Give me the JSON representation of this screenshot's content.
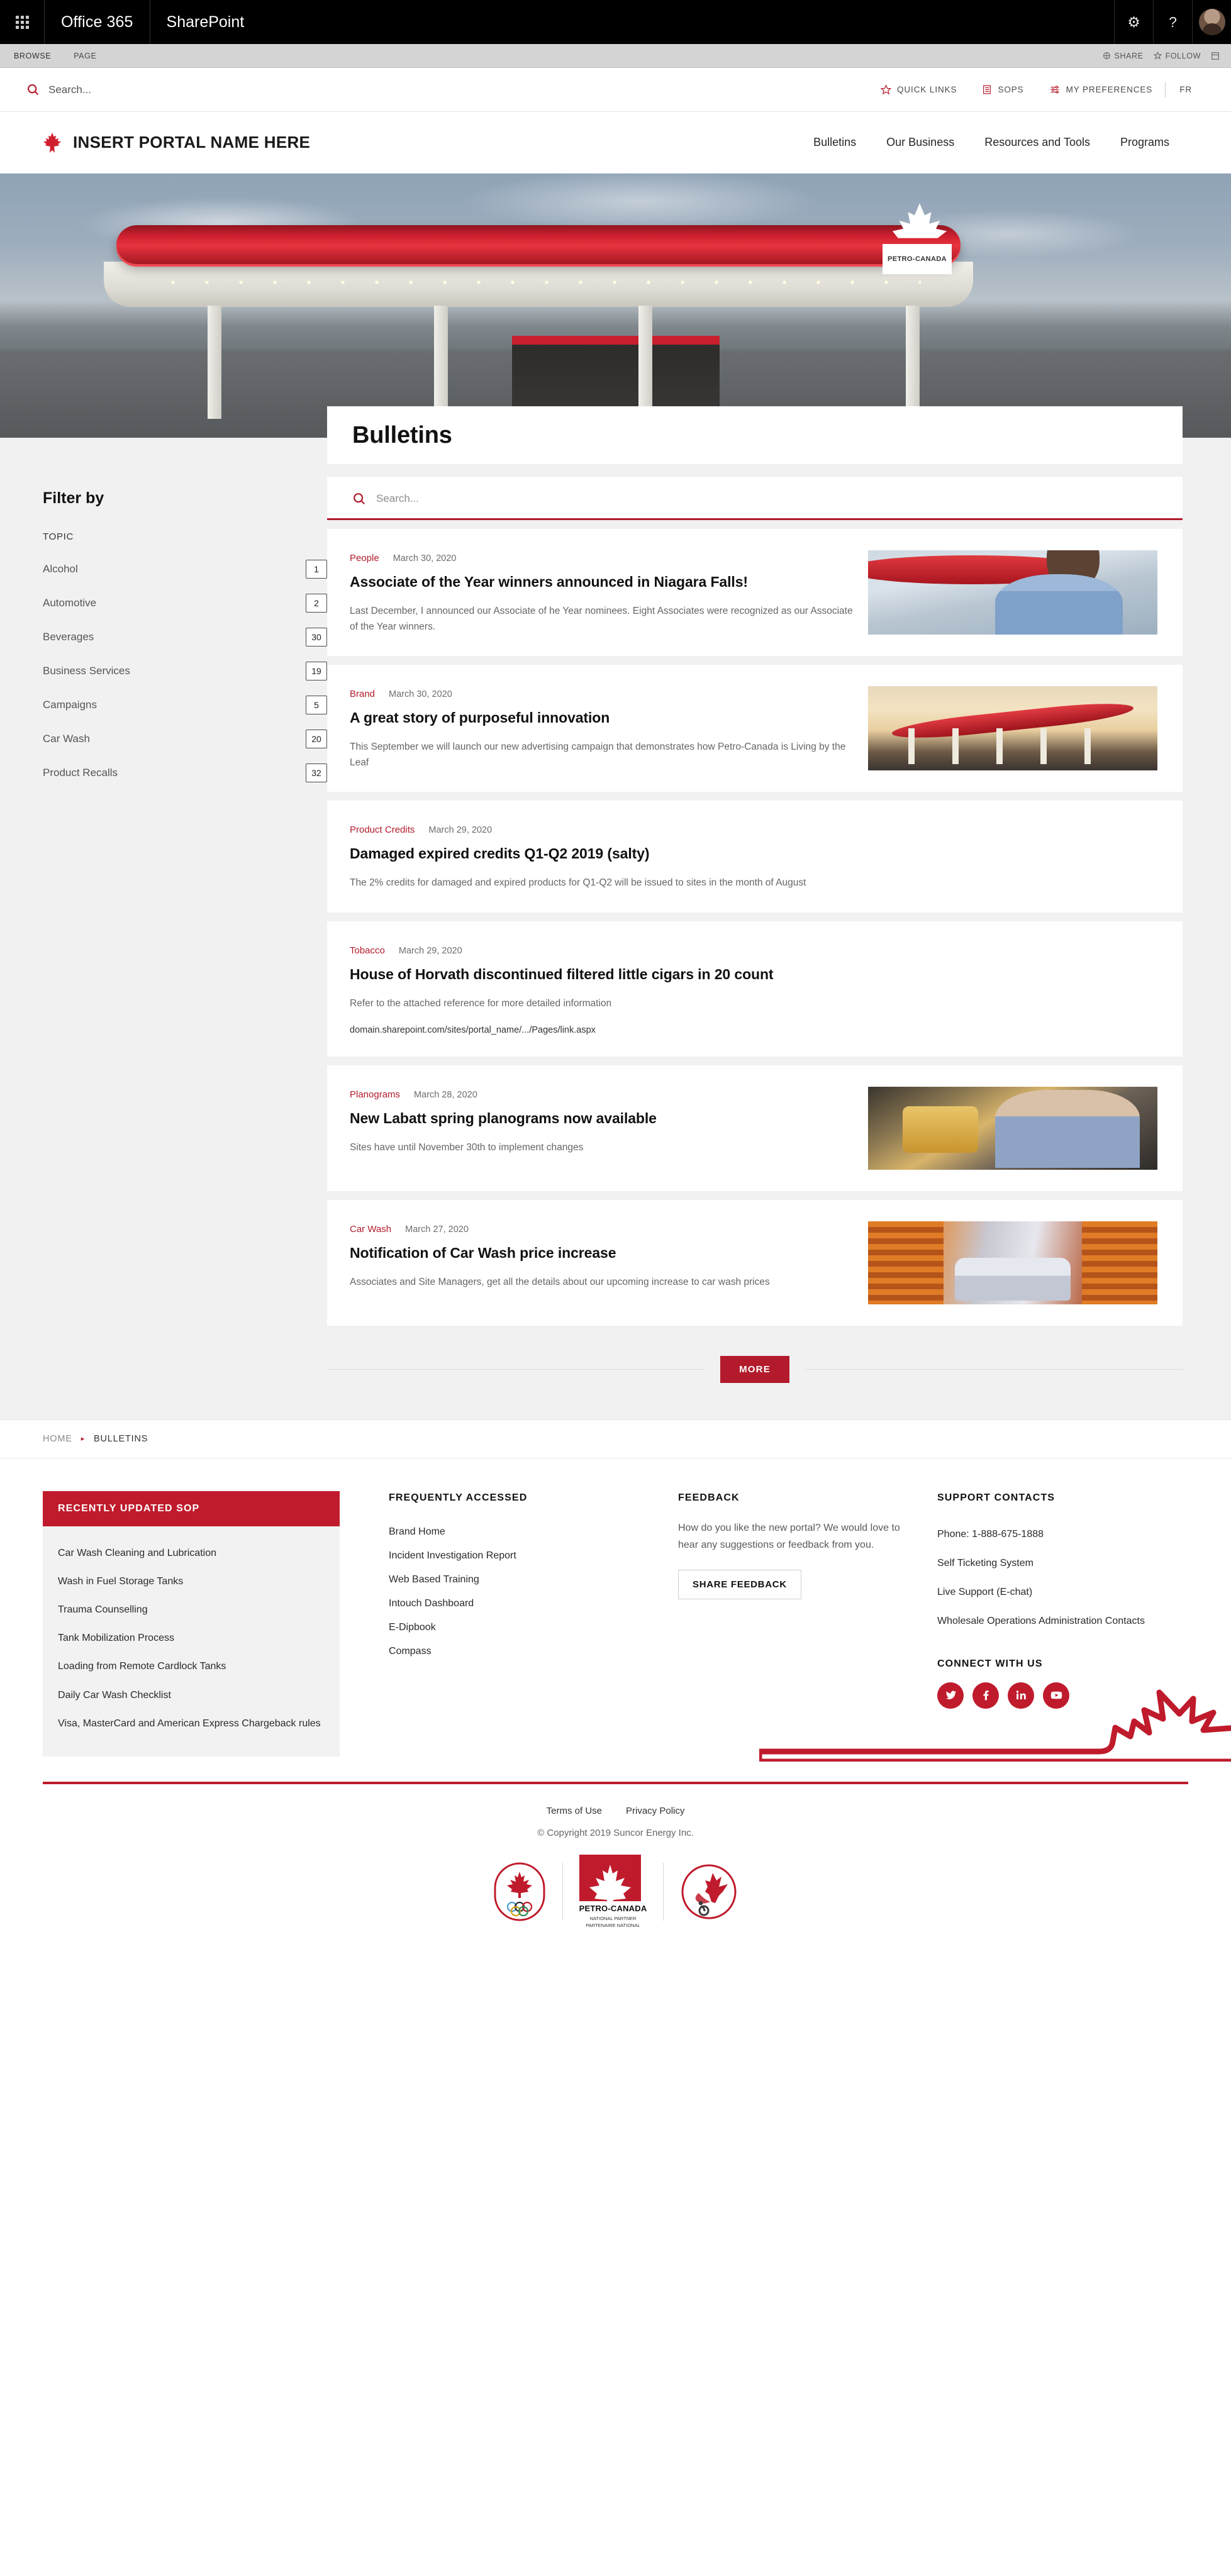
{
  "suitebar": {
    "app_launcher": "app-launcher",
    "office_brand": "Office 365",
    "app_name": "SharePoint",
    "settings_icon": "gear-icon",
    "help_icon": "help-icon",
    "avatar": "user-avatar"
  },
  "ribbon": {
    "tabs": [
      "BROWSE",
      "PAGE"
    ],
    "actions": [
      "SHARE",
      "FOLLOW"
    ],
    "focus_icon": "focus-on-content-icon"
  },
  "utility": {
    "search_placeholder": "Search...",
    "links": [
      {
        "label": "QUICK LINKS",
        "icon": "star-icon"
      },
      {
        "label": "SOPS",
        "icon": "list-icon"
      },
      {
        "label": "MY PREFERENCES",
        "icon": "sliders-icon"
      }
    ],
    "language": "FR"
  },
  "portal": {
    "logo": "maple-leaf-logo",
    "name": "INSERT PORTAL NAME HERE",
    "nav": [
      "Bulletins",
      "Our Business",
      "Resources and Tools",
      "Programs"
    ]
  },
  "hero": {
    "alt": "petro-canada-gas-station-at-dusk",
    "sign_text": "PETRO-CANADA"
  },
  "page": {
    "title": "Bulletins"
  },
  "filter": {
    "heading": "Filter by",
    "group_label": "TOPIC",
    "topics": [
      {
        "name": "Alcohol",
        "count": "1"
      },
      {
        "name": "Automotive",
        "count": "2"
      },
      {
        "name": "Beverages",
        "count": "30"
      },
      {
        "name": "Business Services",
        "count": "19"
      },
      {
        "name": "Campaigns",
        "count": "5"
      },
      {
        "name": "Car Wash",
        "count": "20"
      },
      {
        "name": "Product Recalls",
        "count": "32"
      }
    ]
  },
  "search": {
    "placeholder": "Search...",
    "icon": "search-icon"
  },
  "bulletins": [
    {
      "topic": "People",
      "date": "March 30, 2020",
      "title": "Associate of the Year winners announced in Niagara Falls!",
      "excerpt": "Last December, I announced our Associate of he Year nominees. Eight Associates were recognized as our Associate of the Year winners.",
      "link": "",
      "thumb": "associate-portrait-photo"
    },
    {
      "topic": "Brand",
      "date": "March 30, 2020",
      "title": "A great story of purposeful innovation",
      "excerpt": "This September we will launch our new advertising campaign that demonstrates how Petro-Canada is Living by the Leaf",
      "link": "",
      "thumb": "gas-station-sunset-photo"
    },
    {
      "topic": "Product Credits",
      "date": "March 29, 2020",
      "title": "Damaged expired credits Q1-Q2 2019 (salty)",
      "excerpt": "The 2% credits for damaged and expired products for Q1-Q2 will be issued to sites in the month of August",
      "link": "",
      "thumb": ""
    },
    {
      "topic": "Tobacco",
      "date": "March 29, 2020",
      "title": "House of Horvath discontinued filtered little cigars in 20 count",
      "excerpt": "Refer to the attached reference for more detailed information",
      "link": "domain.sharepoint.com/sites/portal_name/.../Pages/link.aspx",
      "thumb": ""
    },
    {
      "topic": "Planograms",
      "date": "March 28, 2020",
      "title": "New Labatt spring planograms now available",
      "excerpt": "Sites have until November 30th to implement changes",
      "link": "",
      "thumb": "shopper-holding-beverage-photo"
    },
    {
      "topic": "Car Wash",
      "date": "March 27, 2020",
      "title": "Notification of Car Wash price increase",
      "excerpt": "Associates and Site Managers, get all the details about our upcoming increase to car wash prices",
      "link": "",
      "thumb": "car-in-car-wash-photo"
    }
  ],
  "more_button": "MORE",
  "breadcrumb": {
    "home": "HOME",
    "current": "BULLETINS"
  },
  "footer": {
    "sop": {
      "heading": "RECENTLY UPDATED SOP",
      "items": [
        "Car Wash Cleaning and Lubrication",
        "Wash in Fuel Storage Tanks",
        "Trauma Counselling",
        "Tank Mobilization Process",
        "Loading from Remote Cardlock Tanks",
        "Daily Car Wash Checklist",
        "Visa, MasterCard and American Express Chargeback rules"
      ]
    },
    "frequently_accessed": {
      "heading": "FREQUENTLY ACCESSED",
      "items": [
        "Brand Home",
        "Incident Investigation Report",
        "Web Based Training",
        "Intouch Dashboard",
        "E-Dipbook",
        "Compass"
      ]
    },
    "feedback": {
      "heading": "FEEDBACK",
      "text": "How do you like the new portal? We would love to hear any suggestions or feedback from you.",
      "button": "SHARE FEEDBACK"
    },
    "support": {
      "heading": "SUPPORT CONTACTS",
      "items": [
        "Phone: 1-888-675-1888",
        "Self Ticketing System",
        "Live Support (E-chat)",
        "Wholesale Operations Administration Contacts"
      ]
    },
    "connect": {
      "heading": "CONNECT WITH US",
      "socials": [
        "twitter-icon",
        "facebook-icon",
        "linkedin-icon",
        "youtube-icon"
      ]
    },
    "legal": [
      "Terms of Use",
      "Privacy Policy"
    ],
    "copyright": "© Copyright 2019 Suncor Energy Inc.",
    "logos": {
      "olympic": "canadian-olympic-team-logo",
      "petro_word": "PETRO-CANADA",
      "petro_sub": "NATIONAL PARTNER\nPARTENAIRE NATIONAL",
      "paralympic": "canadian-paralympic-team-logo"
    }
  },
  "colors": {
    "brand_red": "#bf1b2c",
    "accent_red": "#b31b2c",
    "page_bg": "#f1f1f1",
    "suitebar": "#000000",
    "ribbon": "#d4d4d4"
  }
}
